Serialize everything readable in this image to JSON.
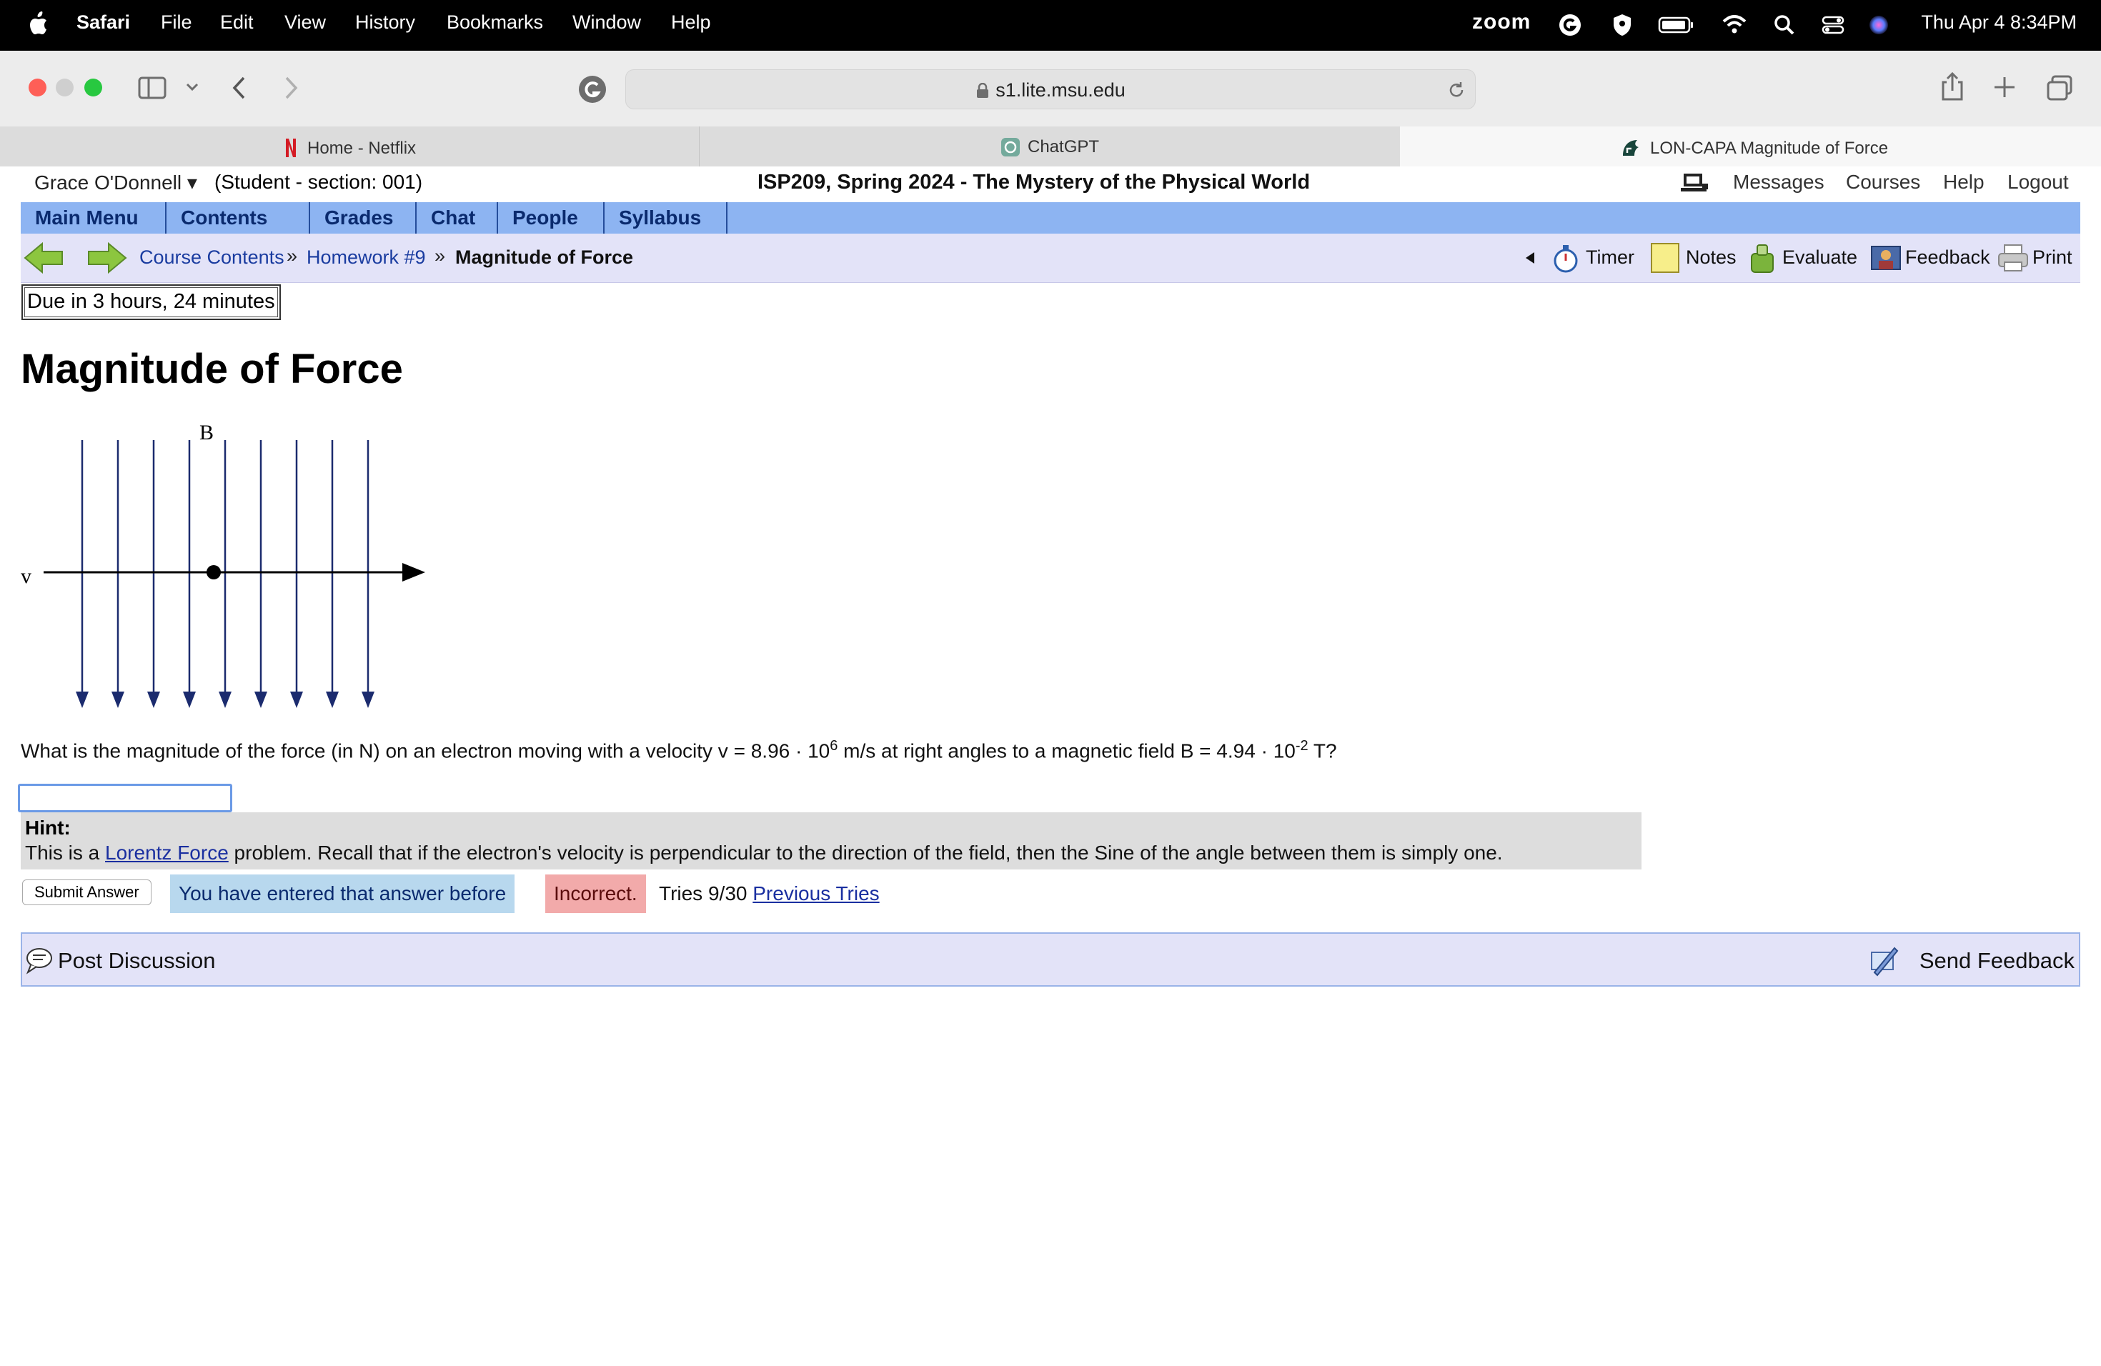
{
  "menubar": {
    "app": "Safari",
    "items": [
      "File",
      "Edit",
      "View",
      "History",
      "Bookmarks",
      "Window",
      "Help"
    ],
    "zoom_label": "zoom",
    "datetime": "Thu Apr 4  8:34PM"
  },
  "browser": {
    "url": "s1.lite.msu.edu",
    "tabs": [
      {
        "label": "Home - Netflix",
        "icon": "netflix-icon"
      },
      {
        "label": "ChatGPT",
        "icon": "chatgpt-icon"
      },
      {
        "label": "LON-CAPA Magnitude of Force",
        "icon": "spartan-icon",
        "active": true
      }
    ]
  },
  "header": {
    "user": "Grace O'Donnell ▾",
    "role": "(Student  - section: 001)",
    "course": "ISP209, Spring 2024 - The Mystery of the Physical World",
    "links": [
      "Messages",
      "Courses",
      "Help",
      "Logout"
    ]
  },
  "mainmenu": [
    "Main Menu",
    "Contents",
    "Grades",
    "Chat",
    "People",
    "Syllabus"
  ],
  "breadcrumb": {
    "items": [
      "Course Contents",
      "Homework #9"
    ],
    "current": "Magnitude of Force",
    "separator": "»"
  },
  "tools": [
    "Timer",
    "Notes",
    "Evaluate",
    "Feedback",
    "Print"
  ],
  "due": "Due in 3 hours, 24 minutes",
  "problem": {
    "title": "Magnitude of Force",
    "diagram_labels": {
      "field": "B",
      "velocity": "v"
    },
    "question_prefix": "What is the magnitude of the force (in N) on an electron moving with a velocity v = 8.96 · 10",
    "question_exp1": "6",
    "question_mid": " m/s at right angles to a magnetic field B = 4.94 · 10",
    "question_exp2": "-2",
    "question_suffix": " T?",
    "answer_value": "",
    "hint_label": "Hint:",
    "hint_prefix": "This is a ",
    "hint_link": "Lorentz Force",
    "hint_suffix": " problem. Recall that if the electron's velocity is perpendicular to the direction of the field, then the Sine of the angle between them is simply one."
  },
  "submission": {
    "submit_label": "Submit Answer",
    "entered_before": "You have entered that answer before",
    "status": "Incorrect.",
    "tries": "Tries 9/30 ",
    "previous_tries": "Previous Tries"
  },
  "discussion": {
    "post": "Post Discussion",
    "feedback": "Send Feedback"
  },
  "colors": {
    "menu_blue": "#8db4f2",
    "nav_lavender": "#e3e3f8",
    "entered_bg": "#b8d8ee",
    "incorrect_bg": "#f2aaaa",
    "field_line": "#1b2b6e"
  }
}
